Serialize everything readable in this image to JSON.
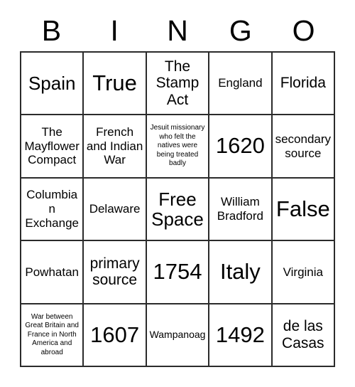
{
  "card": {
    "title": "BINGO",
    "header_letters": [
      "B",
      "I",
      "N",
      "G",
      "O"
    ],
    "border_color": "#2b2b2b",
    "background_color": "#ffffff",
    "text_color": "#000000",
    "columns": 5,
    "rows": 5,
    "free_space_position": "N3"
  },
  "cells": [
    {
      "text": "Spain",
      "size": "s-xl"
    },
    {
      "text": "True",
      "size": "s-xxl"
    },
    {
      "text": "The Stamp Act",
      "size": "s-lg"
    },
    {
      "text": "England",
      "size": "s-md"
    },
    {
      "text": "Florida",
      "size": "s-lg"
    },
    {
      "text": "The Mayflower Compact",
      "size": "s-md"
    },
    {
      "text": "French and Indian War",
      "size": "s-md"
    },
    {
      "text": "Jesuit missionary who felt the natives were being treated badly",
      "size": "s-xs"
    },
    {
      "text": "1620",
      "size": "s-xxl"
    },
    {
      "text": "secondary source",
      "size": "s-md"
    },
    {
      "text": "Columbian Exchange",
      "size": "s-md"
    },
    {
      "text": "Delaware",
      "size": "s-md"
    },
    {
      "text": "Free Space",
      "size": "s-xl"
    },
    {
      "text": "William Bradford",
      "size": "s-md"
    },
    {
      "text": "False",
      "size": "s-xxl"
    },
    {
      "text": "Powhatan",
      "size": "s-md"
    },
    {
      "text": "primary source",
      "size": "s-lg"
    },
    {
      "text": "1754",
      "size": "s-xxl"
    },
    {
      "text": "Italy",
      "size": "s-xxl"
    },
    {
      "text": "Virginia",
      "size": "s-md"
    },
    {
      "text": "War between Great Britain and France in North America and abroad",
      "size": "s-xs"
    },
    {
      "text": "1607",
      "size": "s-xxl"
    },
    {
      "text": "Wampanoag",
      "size": "s-sm"
    },
    {
      "text": "1492",
      "size": "s-xxl"
    },
    {
      "text": "de las Casas",
      "size": "s-lg"
    }
  ]
}
